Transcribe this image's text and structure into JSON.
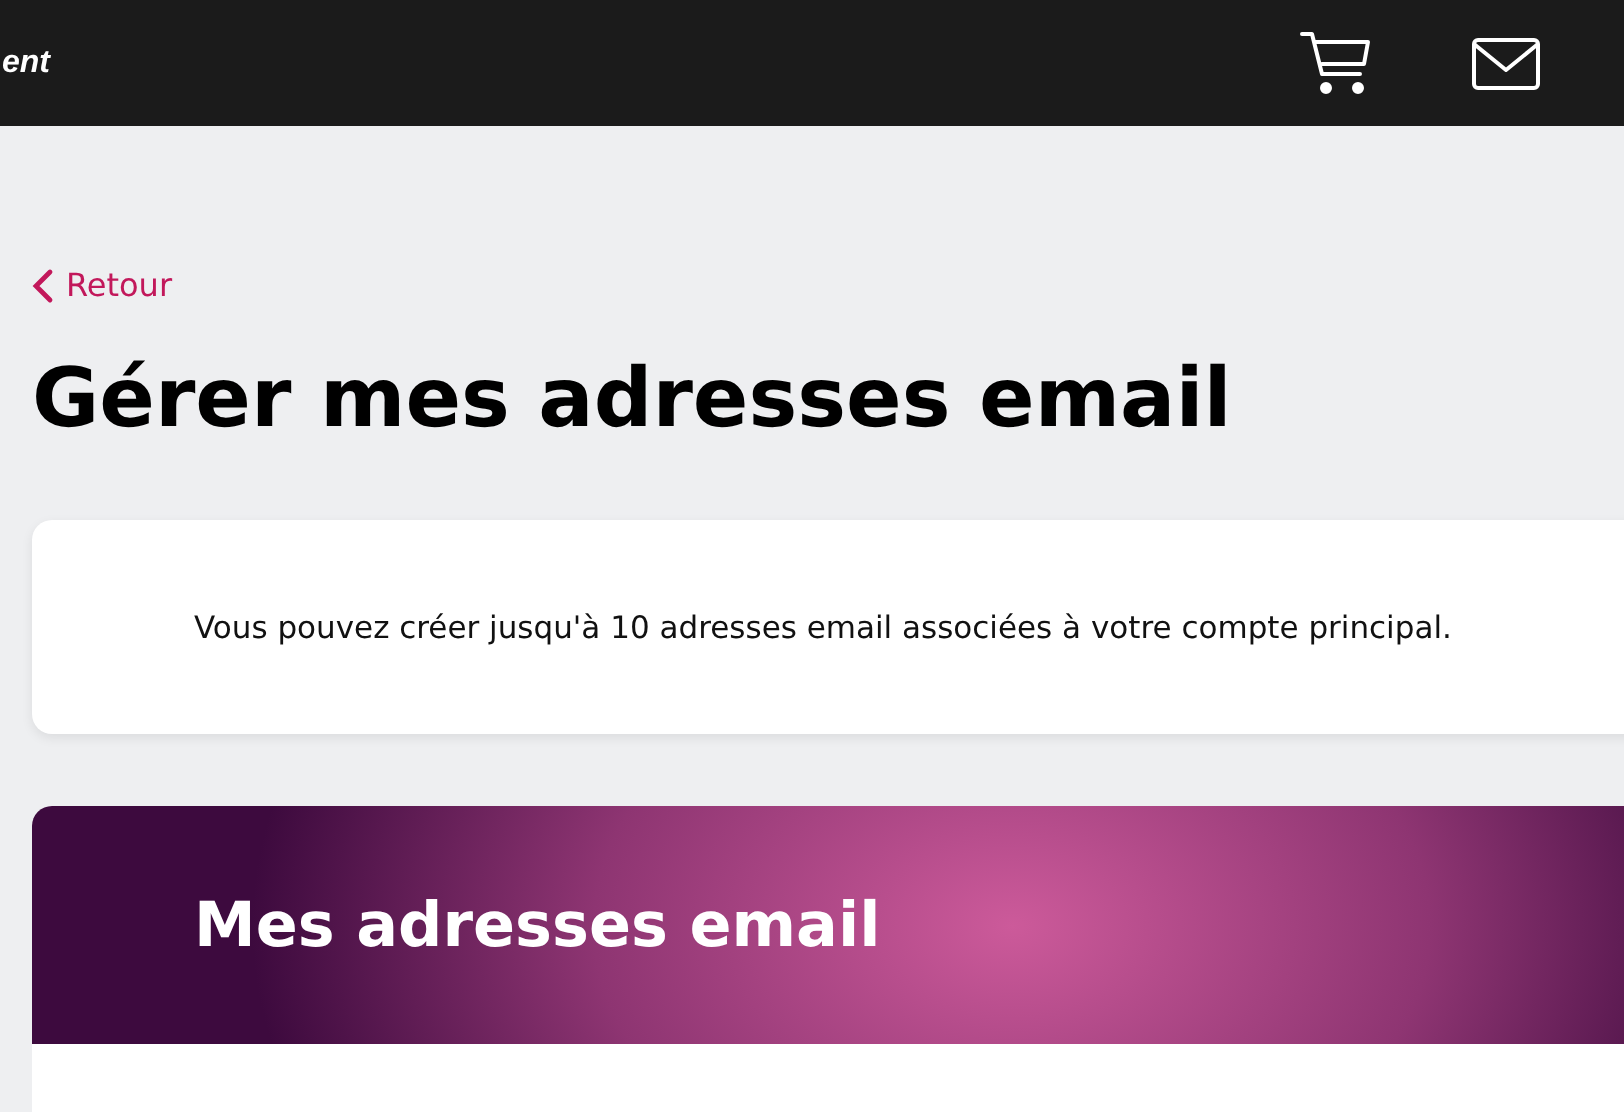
{
  "header": {
    "brand": "ent"
  },
  "back_link": {
    "label": "Retour"
  },
  "title": "Gérer mes adresses email",
  "info_card": {
    "text": "Vous pouvez créer jusqu'à 10 adresses email associées à votre compte principal."
  },
  "addresses_panel": {
    "title": "Mes adresses email"
  }
}
